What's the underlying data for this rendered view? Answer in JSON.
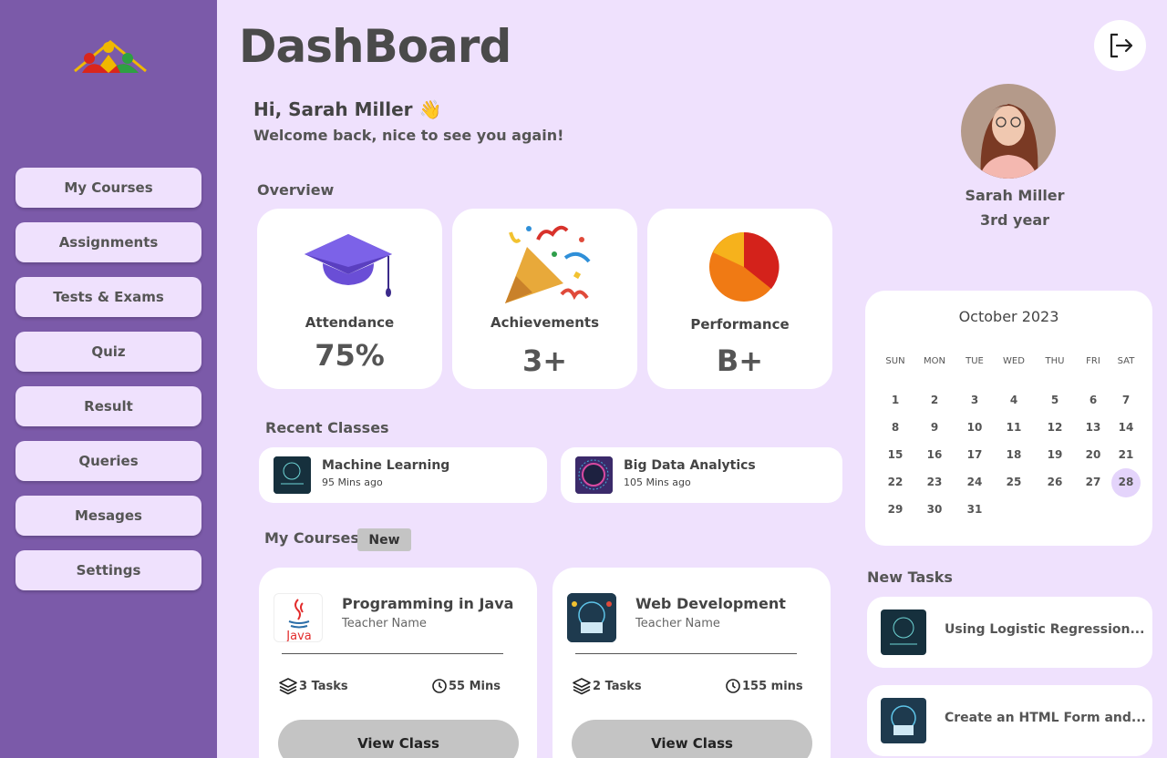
{
  "header": {
    "title": "DashBoard"
  },
  "sidebar": {
    "items": [
      {
        "label": "My Courses"
      },
      {
        "label": "Assignments"
      },
      {
        "label": "Tests & Exams"
      },
      {
        "label": "Quiz"
      },
      {
        "label": "Result"
      },
      {
        "label": "Queries"
      },
      {
        "label": "Mesages"
      },
      {
        "label": "Settings"
      }
    ]
  },
  "greeting": {
    "hi": "Hi, Sarah Miller 👋",
    "welcome": "Welcome back, nice to see you again!"
  },
  "overview": {
    "title": "Overview",
    "cards": [
      {
        "label": "Attendance",
        "value": "75%",
        "icon": "graduation-cap-icon"
      },
      {
        "label": "Achievements",
        "value": "3+",
        "icon": "party-popper-icon"
      },
      {
        "label": "Performance",
        "value": "B+",
        "icon": "pie-chart-icon"
      }
    ]
  },
  "recent": {
    "title": "Recent Classes",
    "items": [
      {
        "title": "Machine Learning",
        "time": "95 Mins ago"
      },
      {
        "title": "Big Data Analytics",
        "time": "105 Mins ago"
      }
    ]
  },
  "courses": {
    "title": "My Courses",
    "badge": "New",
    "items": [
      {
        "title": "Programming in Java",
        "teacher": "Teacher Name",
        "tasks": "3 Tasks",
        "duration": "55 Mins",
        "button": "View Class"
      },
      {
        "title": "Web Development",
        "teacher": "Teacher Name",
        "tasks": "2 Tasks",
        "duration": "155 mins",
        "button": "View Class"
      }
    ]
  },
  "profile": {
    "name": "Sarah Miller",
    "year": "3rd year"
  },
  "calendar": {
    "title": "October 2023",
    "weekdays": [
      "SUN",
      "MON",
      "TUE",
      "WED",
      "THU",
      "FRI",
      "SAT"
    ],
    "start_weekday": 0,
    "days_in_month": 31,
    "selected": 28
  },
  "tasks": {
    "title": "New Tasks",
    "items": [
      {
        "text": "Using Logistic Regression..."
      },
      {
        "text": "Create an HTML Form and..."
      }
    ]
  },
  "colors": {
    "sidebar": "#7b5aa9",
    "background": "#efe1fd",
    "button": "#c4c4c4",
    "highlight": "#e4d4fb"
  }
}
